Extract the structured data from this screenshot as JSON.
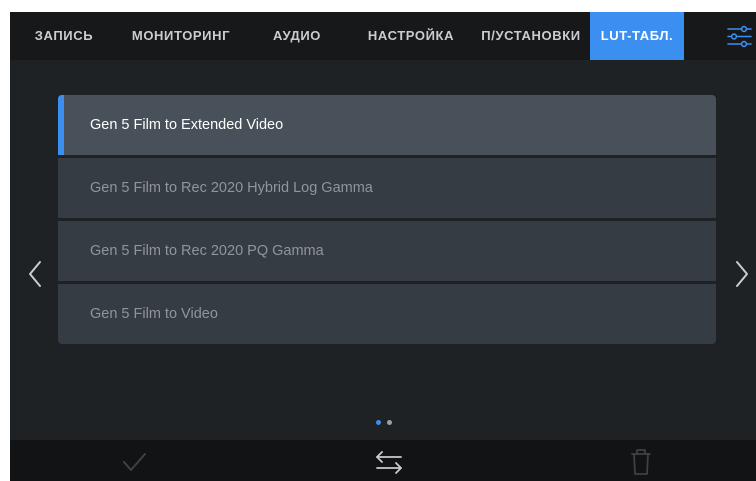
{
  "tabs": [
    {
      "label": "ЗАПИСЬ",
      "active": false
    },
    {
      "label": "МОНИТОРИНГ",
      "active": false
    },
    {
      "label": "АУДИО",
      "active": false
    },
    {
      "label": "НАСТРОЙКА",
      "active": false
    },
    {
      "label": "П/УСТАНОВКИ",
      "active": false
    },
    {
      "label": "LUT-ТАБЛ.",
      "active": true
    }
  ],
  "settings_icon": "sliders-icon",
  "lut_list": [
    {
      "label": "Gen 5 Film to Extended Video",
      "selected": true
    },
    {
      "label": "Gen 5 Film to Rec 2020 Hybrid Log Gamma",
      "selected": false
    },
    {
      "label": "Gen 5 Film to Rec 2020 PQ Gamma",
      "selected": false
    },
    {
      "label": "Gen 5 Film to Video",
      "selected": false
    }
  ],
  "pagination": {
    "pages": 2,
    "current": 1
  },
  "navigation": {
    "prev_icon": "chevron-left-icon",
    "next_icon": "chevron-right-icon"
  },
  "bottom_bar": {
    "confirm_icon": "checkmark-icon",
    "transfer_icon": "swap-arrows-icon",
    "delete_icon": "trash-icon"
  },
  "colors": {
    "accent": "#3a8ff0",
    "background": "#1f2224",
    "row": "#363c43",
    "row_selected": "#48505a",
    "tabbar": "#16181a",
    "bottombar": "#121314"
  }
}
